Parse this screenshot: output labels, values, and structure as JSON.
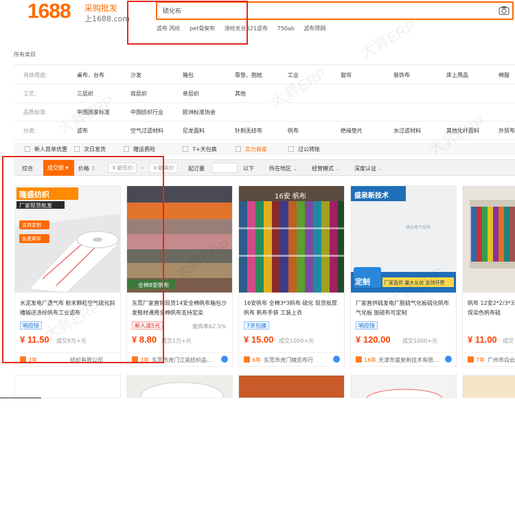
{
  "header": {
    "logo": "1688",
    "logo_sub1": "采购批发",
    "logo_sub2": "上1688.com",
    "search_value": "硫化布",
    "hot_words": [
      "滤布 丙纶",
      "pet骨架布",
      "涤纶长丝621滤布",
      "750ab",
      "滤布筛网"
    ]
  },
  "all_category": "所有类目",
  "filters": [
    {
      "label": "具体用途:",
      "items": [
        "桌布、台布",
        "沙发",
        "箱包",
        "靠垫、抱枕",
        "工业",
        "窗帘",
        "装饰布",
        "床上用品",
        "棉服"
      ]
    },
    {
      "label": "工艺:",
      "items": [
        "三层织",
        "双层织",
        "单层织",
        "其他"
      ]
    },
    {
      "label": "品质标准:",
      "items": [
        "中国国家标准",
        "中国纺织行业",
        "欧洲标准协会"
      ]
    },
    {
      "label": "分类:",
      "items": [
        "滤布",
        "空气过滤材料",
        "尼龙面料",
        "针刺无纺布",
        "帆布",
        "绝缘垫片",
        "水过滤材料",
        "其他化纤面料",
        "外贸布"
      ]
    }
  ],
  "checks": [
    "新人首单优惠",
    "次日发货",
    "赠运费险",
    "7+天包换",
    "实力商家",
    "过公转账"
  ],
  "sort": {
    "general": "综合",
    "active": "成交额",
    "price": "价格",
    "min_price": "￥最低价",
    "dash": "-",
    "max_price": "￥最高价",
    "min_order": "起订量",
    "below": "以下",
    "location": "所在地区",
    "mode": "经营模式",
    "auth": "深度认证"
  },
  "products": [
    {
      "img_title": "隆盛纺织",
      "img_sub": "厂家现货批发",
      "img_badge1": "支持定制",
      "img_badge2": "免费拿样",
      "title": "水泥发电厂透气布 粉末颗粒空气硫化斜槽输送涤纶帆布工业滤布",
      "tag": "响应快",
      "tag_style": "blue",
      "price": "¥ 11.50",
      "sold": "成交8万+元",
      "years": "3年",
      "seller": "纺织有限公司"
    },
    {
      "img_title": "全棉8安帆布",
      "title": "东莞厂家直销现货14安全棉帆布箱包沙发鞋材通用全棉帆布支持定染",
      "tag": "新人减5元",
      "tag_style": "red",
      "repurchase": "复购率62.5%",
      "price": "¥ 8.80",
      "sold": "成交1万+元",
      "years": "3年",
      "seller": "东莞市虎门江英纺织品..."
    },
    {
      "img_title": "16安 帆布",
      "title": "16安帆布 全棉3*3帆布 硫化 现货批厚帆布 帆布手袋 工装上衣",
      "tag": "7天包换",
      "tag_style": "blue",
      "price": "¥ 15.00",
      "sold": "成交1000+元",
      "years": "6年",
      "seller": "东莞市虎门精凯布行"
    },
    {
      "img_title": "盛泉新技术",
      "img_sub": "定制",
      "img_badge1": "厂家直供 量大从优 支持开票",
      "img_label": "硫化电气化布",
      "title": "厂家直供硫发电厂脱硫气化板硫化帆布 气化板 脱硫布可定制",
      "tag": "响应快",
      "tag_style": "blue",
      "price": "¥ 120.00",
      "sold": "成交1000+元",
      "years": "16年",
      "seller": "天津市盛泉新技术有限..."
    },
    {
      "title": "帆布 12安2*2/3*3环保染色帆布硫",
      "price": "¥ 11.00",
      "sold": "成交",
      "years": "7年",
      "seller": "广州市白云"
    }
  ],
  "watermark": "大昇ERP",
  "colors": {
    "brand": "#ff6a00",
    "highlight": "#e0281f",
    "price": "#ff4000"
  }
}
